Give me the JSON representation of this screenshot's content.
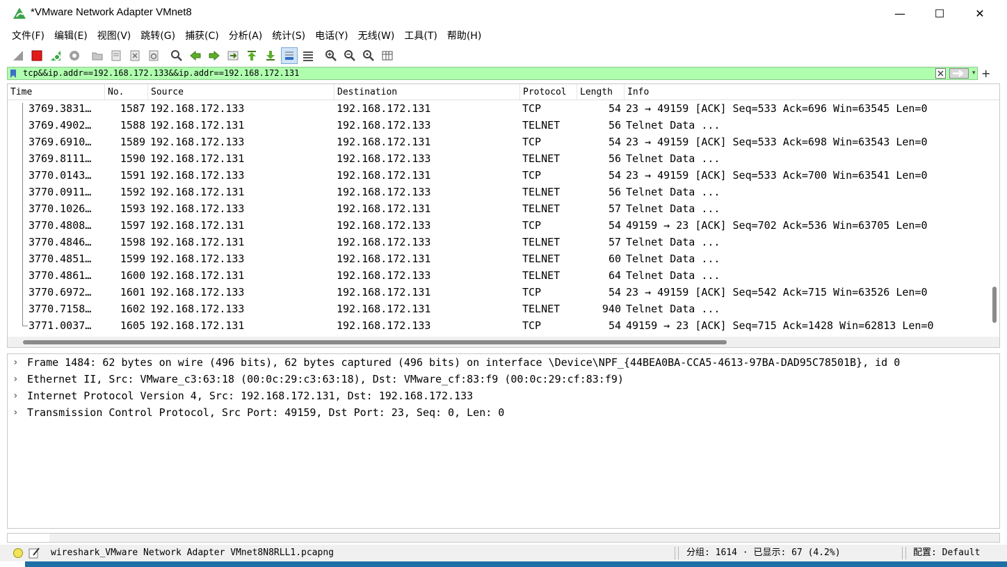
{
  "window": {
    "title": "*VMware Network Adapter VMnet8",
    "minimize_glyph": "—",
    "maximize_glyph": "☐",
    "close_glyph": "✕"
  },
  "menu": [
    "文件(F)",
    "编辑(E)",
    "视图(V)",
    "跳转(G)",
    "捕获(C)",
    "分析(A)",
    "统计(S)",
    "电话(Y)",
    "无线(W)",
    "工具(T)",
    "帮助(H)"
  ],
  "toolbar": {
    "icons": [
      "shark-fin-start-icon",
      "stop-capture-icon",
      "restart-capture-icon",
      "capture-options-icon",
      "open-file-icon",
      "save-file-icon",
      "close-file-icon",
      "reload-file-icon",
      "find-packet-icon",
      "go-back-icon",
      "go-forward-icon",
      "go-to-packet-icon",
      "go-first-icon",
      "go-last-icon",
      "autoscroll-icon",
      "colorize-icon",
      "zoom-in-icon",
      "zoom-out-icon",
      "zoom-normal-icon",
      "resize-columns-icon"
    ]
  },
  "filter": {
    "value": "tcp&&ip.addr==192.168.172.133&&ip.addr==192.168.172.131",
    "bg_color": "#afffaf",
    "dropdown_glyph": "▾",
    "add_glyph": "+"
  },
  "packet_list": {
    "columns": [
      "Time",
      "No.",
      "Source",
      "Destination",
      "Protocol",
      "Length",
      "Info"
    ],
    "rows": [
      {
        "time": "3769.3831…",
        "no": "1587",
        "src": "192.168.172.133",
        "dst": "192.168.172.131",
        "proto": "TCP",
        "len": "54",
        "info": "23 → 49159 [ACK] Seq=533 Ack=696 Win=63545 Len=0"
      },
      {
        "time": "3769.4902…",
        "no": "1588",
        "src": "192.168.172.131",
        "dst": "192.168.172.133",
        "proto": "TELNET",
        "len": "56",
        "info": "Telnet Data ..."
      },
      {
        "time": "3769.6910…",
        "no": "1589",
        "src": "192.168.172.133",
        "dst": "192.168.172.131",
        "proto": "TCP",
        "len": "54",
        "info": "23 → 49159 [ACK] Seq=533 Ack=698 Win=63543 Len=0"
      },
      {
        "time": "3769.8111…",
        "no": "1590",
        "src": "192.168.172.131",
        "dst": "192.168.172.133",
        "proto": "TELNET",
        "len": "56",
        "info": "Telnet Data ..."
      },
      {
        "time": "3770.0143…",
        "no": "1591",
        "src": "192.168.172.133",
        "dst": "192.168.172.131",
        "proto": "TCP",
        "len": "54",
        "info": "23 → 49159 [ACK] Seq=533 Ack=700 Win=63541 Len=0"
      },
      {
        "time": "3770.0911…",
        "no": "1592",
        "src": "192.168.172.131",
        "dst": "192.168.172.133",
        "proto": "TELNET",
        "len": "56",
        "info": "Telnet Data ..."
      },
      {
        "time": "3770.1026…",
        "no": "1593",
        "src": "192.168.172.133",
        "dst": "192.168.172.131",
        "proto": "TELNET",
        "len": "57",
        "info": "Telnet Data ..."
      },
      {
        "time": "3770.4808…",
        "no": "1597",
        "src": "192.168.172.131",
        "dst": "192.168.172.133",
        "proto": "TCP",
        "len": "54",
        "info": "49159 → 23 [ACK] Seq=702 Ack=536 Win=63705 Len=0"
      },
      {
        "time": "3770.4846…",
        "no": "1598",
        "src": "192.168.172.131",
        "dst": "192.168.172.133",
        "proto": "TELNET",
        "len": "57",
        "info": "Telnet Data ..."
      },
      {
        "time": "3770.4851…",
        "no": "1599",
        "src": "192.168.172.133",
        "dst": "192.168.172.131",
        "proto": "TELNET",
        "len": "60",
        "info": "Telnet Data ..."
      },
      {
        "time": "3770.4861…",
        "no": "1600",
        "src": "192.168.172.131",
        "dst": "192.168.172.133",
        "proto": "TELNET",
        "len": "64",
        "info": "Telnet Data ..."
      },
      {
        "time": "3770.6972…",
        "no": "1601",
        "src": "192.168.172.133",
        "dst": "192.168.172.131",
        "proto": "TCP",
        "len": "54",
        "info": "23 → 49159 [ACK] Seq=542 Ack=715 Win=63526 Len=0"
      },
      {
        "time": "3770.7158…",
        "no": "1602",
        "src": "192.168.172.133",
        "dst": "192.168.172.131",
        "proto": "TELNET",
        "len": "940",
        "info": "Telnet Data ..."
      },
      {
        "time": "3771.0037…",
        "no": "1605",
        "src": "192.168.172.131",
        "dst": "192.168.172.133",
        "proto": "TCP",
        "len": "54",
        "info": "49159 → 23 [ACK] Seq=715 Ack=1428 Win=62813 Len=0"
      }
    ]
  },
  "details": {
    "chevron": "›",
    "rows": [
      {
        "text": "Frame 1484: 62 bytes on wire (496 bits), 62 bytes captured (496 bits) on interface \\Device\\NPF_{44BEA0BA-CCA5-4613-97BA-DAD95C78501B}, id 0"
      },
      {
        "text": "Ethernet II, Src: VMware_c3:63:18 (00:0c:29:c3:63:18), Dst: VMware_cf:83:f9 (00:0c:29:cf:83:f9)"
      },
      {
        "text": "Internet Protocol Version 4, Src: 192.168.172.131, Dst: 192.168.172.133"
      },
      {
        "text": "Transmission Control Protocol, Src Port: 49159, Dst Port: 23, Seq: 0, Len: 0"
      }
    ],
    "selected_color": "#80b4f2"
  },
  "status": {
    "file": "wireshark_VMware Network Adapter VMnet8N8RLL1.pcapng",
    "stats": "分组: 1614 · 已显示: 67 (4.2%)",
    "profile": "配置: Default"
  }
}
